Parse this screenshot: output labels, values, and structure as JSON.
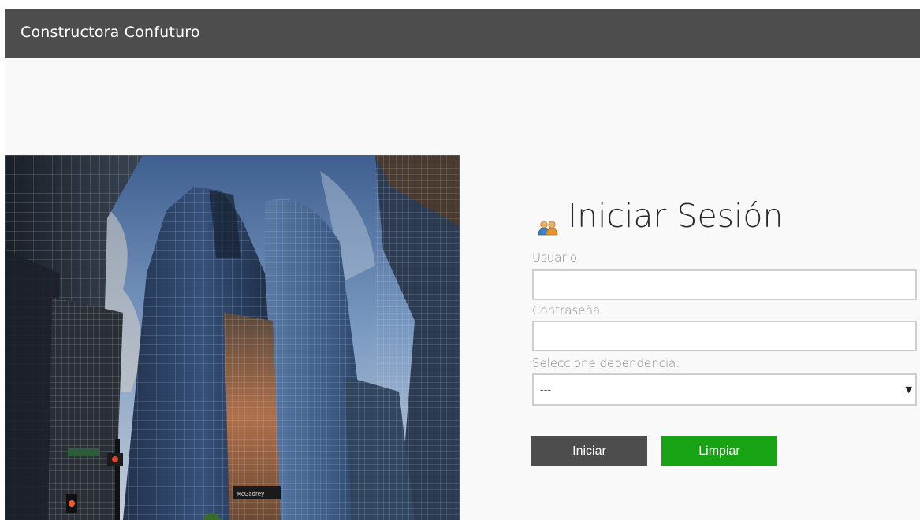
{
  "header": {
    "title": "Constructora Confuturo"
  },
  "hero": {
    "credit": "",
    "street_sign": "",
    "building_sign": "McGadrey"
  },
  "login": {
    "title": "Iniciar Sesión",
    "icon": "users-icon",
    "username": {
      "label": "Usuario:",
      "value": "",
      "placeholder": ""
    },
    "password": {
      "label": "Contraseña:",
      "value": "",
      "placeholder": ""
    },
    "dependency": {
      "label": "Seleccione dependencia:",
      "selected": "---"
    },
    "submit_label": "Iniciar",
    "clear_label": "Limpiar"
  },
  "colors": {
    "header_bg": "#4d4d4d",
    "submit_bg": "#4d4d4d",
    "clear_bg": "#17a313"
  }
}
